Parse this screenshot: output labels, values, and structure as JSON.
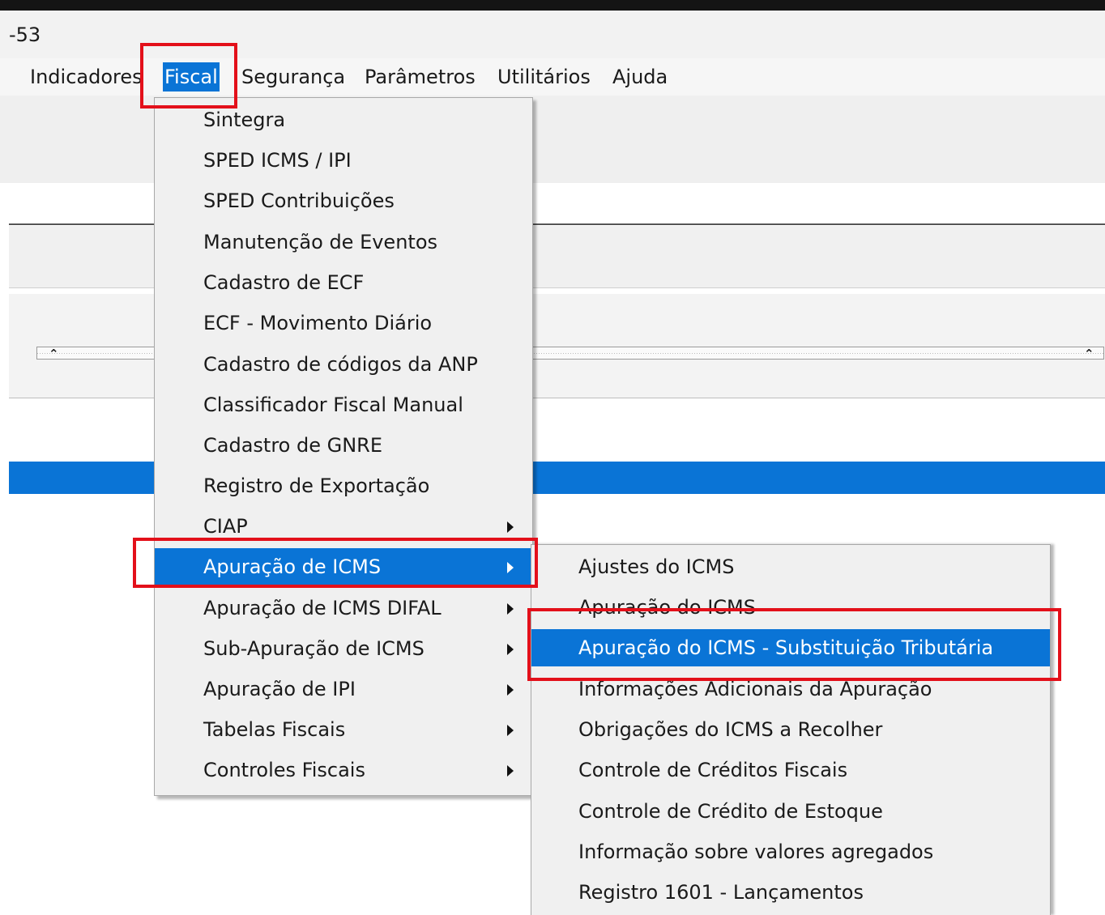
{
  "window": {
    "title": "-53"
  },
  "menubar": {
    "items": [
      {
        "label": "Indicadores"
      },
      {
        "label": "Fiscal"
      },
      {
        "label": "Segurança"
      },
      {
        "label": "Parâmetros"
      },
      {
        "label": "Utilitários"
      },
      {
        "label": "Ajuda"
      }
    ],
    "selected": "Fiscal"
  },
  "fiscal_menu": {
    "items": [
      {
        "label": "Sintegra"
      },
      {
        "label": "SPED ICMS / IPI"
      },
      {
        "label": "SPED Contribuições"
      },
      {
        "label": "Manutenção de Eventos"
      },
      {
        "label": "Cadastro de ECF"
      },
      {
        "label": "ECF - Movimento Diário"
      },
      {
        "label": "Cadastro de códigos da ANP"
      },
      {
        "label": "Classificador Fiscal Manual"
      },
      {
        "label": "Cadastro de GNRE"
      },
      {
        "label": "Registro de Exportação"
      },
      {
        "label": "CIAP"
      },
      {
        "label": "Apuração de ICMS"
      },
      {
        "label": "Apuração de ICMS DIFAL"
      },
      {
        "label": "Sub-Apuração de ICMS"
      },
      {
        "label": "Apuração de IPI"
      },
      {
        "label": "Tabelas Fiscais"
      },
      {
        "label": "Controles Fiscais"
      }
    ],
    "selected": "Apuração de ICMS"
  },
  "apuracao_submenu": {
    "items": [
      {
        "label": "Ajustes do ICMS"
      },
      {
        "label": "Apuração do ICMS"
      },
      {
        "label": "Apuração do ICMS - Substituição Tributária"
      },
      {
        "label": "Informações Adicionais da Apuração"
      },
      {
        "label": "Obrigações do ICMS a Recolher"
      },
      {
        "label": "Controle de Créditos Fiscais"
      },
      {
        "label": "Controle de Crédito de Estoque"
      },
      {
        "label": "Informação sobre valores agregados"
      },
      {
        "label": "Registro 1601 - Lançamentos"
      }
    ],
    "selected": "Apuração do ICMS - Substituição Tributária"
  },
  "colors": {
    "selection": "#0a74d6",
    "highlight_frame": "#e3101a",
    "menu_background": "#f0f0f0"
  }
}
